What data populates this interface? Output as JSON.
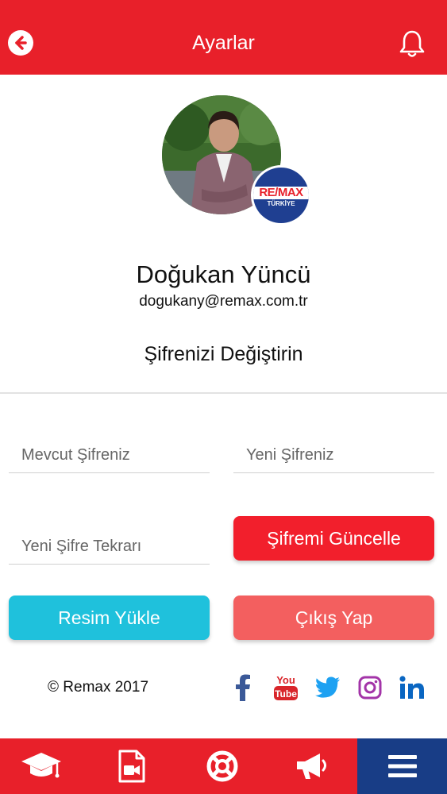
{
  "header": {
    "title": "Ayarlar",
    "back_icon": "arrow-left-icon",
    "bell_icon": "bell-icon"
  },
  "profile": {
    "name": "Doğukan Yüncü",
    "email": "dogukany@remax.com.tr",
    "badge_brand": "RE/MAX",
    "badge_sub": "TÜRKİYE"
  },
  "password": {
    "section_title": "Şifrenizi Değiştirin",
    "current_placeholder": "Mevcut Şifreniz",
    "new_placeholder": "Yeni Şifreniz",
    "repeat_placeholder": "Yeni Şifre Tekrarı",
    "update_label": "Şifremi Güncelle"
  },
  "actions": {
    "upload_label": "Resim Yükle",
    "logout_label": "Çıkış Yap"
  },
  "footer": {
    "copyright": "© Remax 2017",
    "social": [
      "facebook-icon",
      "youtube-icon",
      "twitter-icon",
      "instagram-icon",
      "linkedin-icon"
    ],
    "youtube_text_top": "You",
    "youtube_text_bottom": "Tube"
  },
  "tabbar": {
    "items": [
      "graduation-cap-icon",
      "video-file-icon",
      "lifebuoy-icon",
      "megaphone-icon",
      "menu-icon"
    ],
    "active_index": 4
  },
  "colors": {
    "brand_red": "#e8202a",
    "tab_active": "#183d86",
    "update_button": "#f21f2c",
    "upload_button": "#1fc1dc",
    "logout_button": "#f35f5f"
  }
}
